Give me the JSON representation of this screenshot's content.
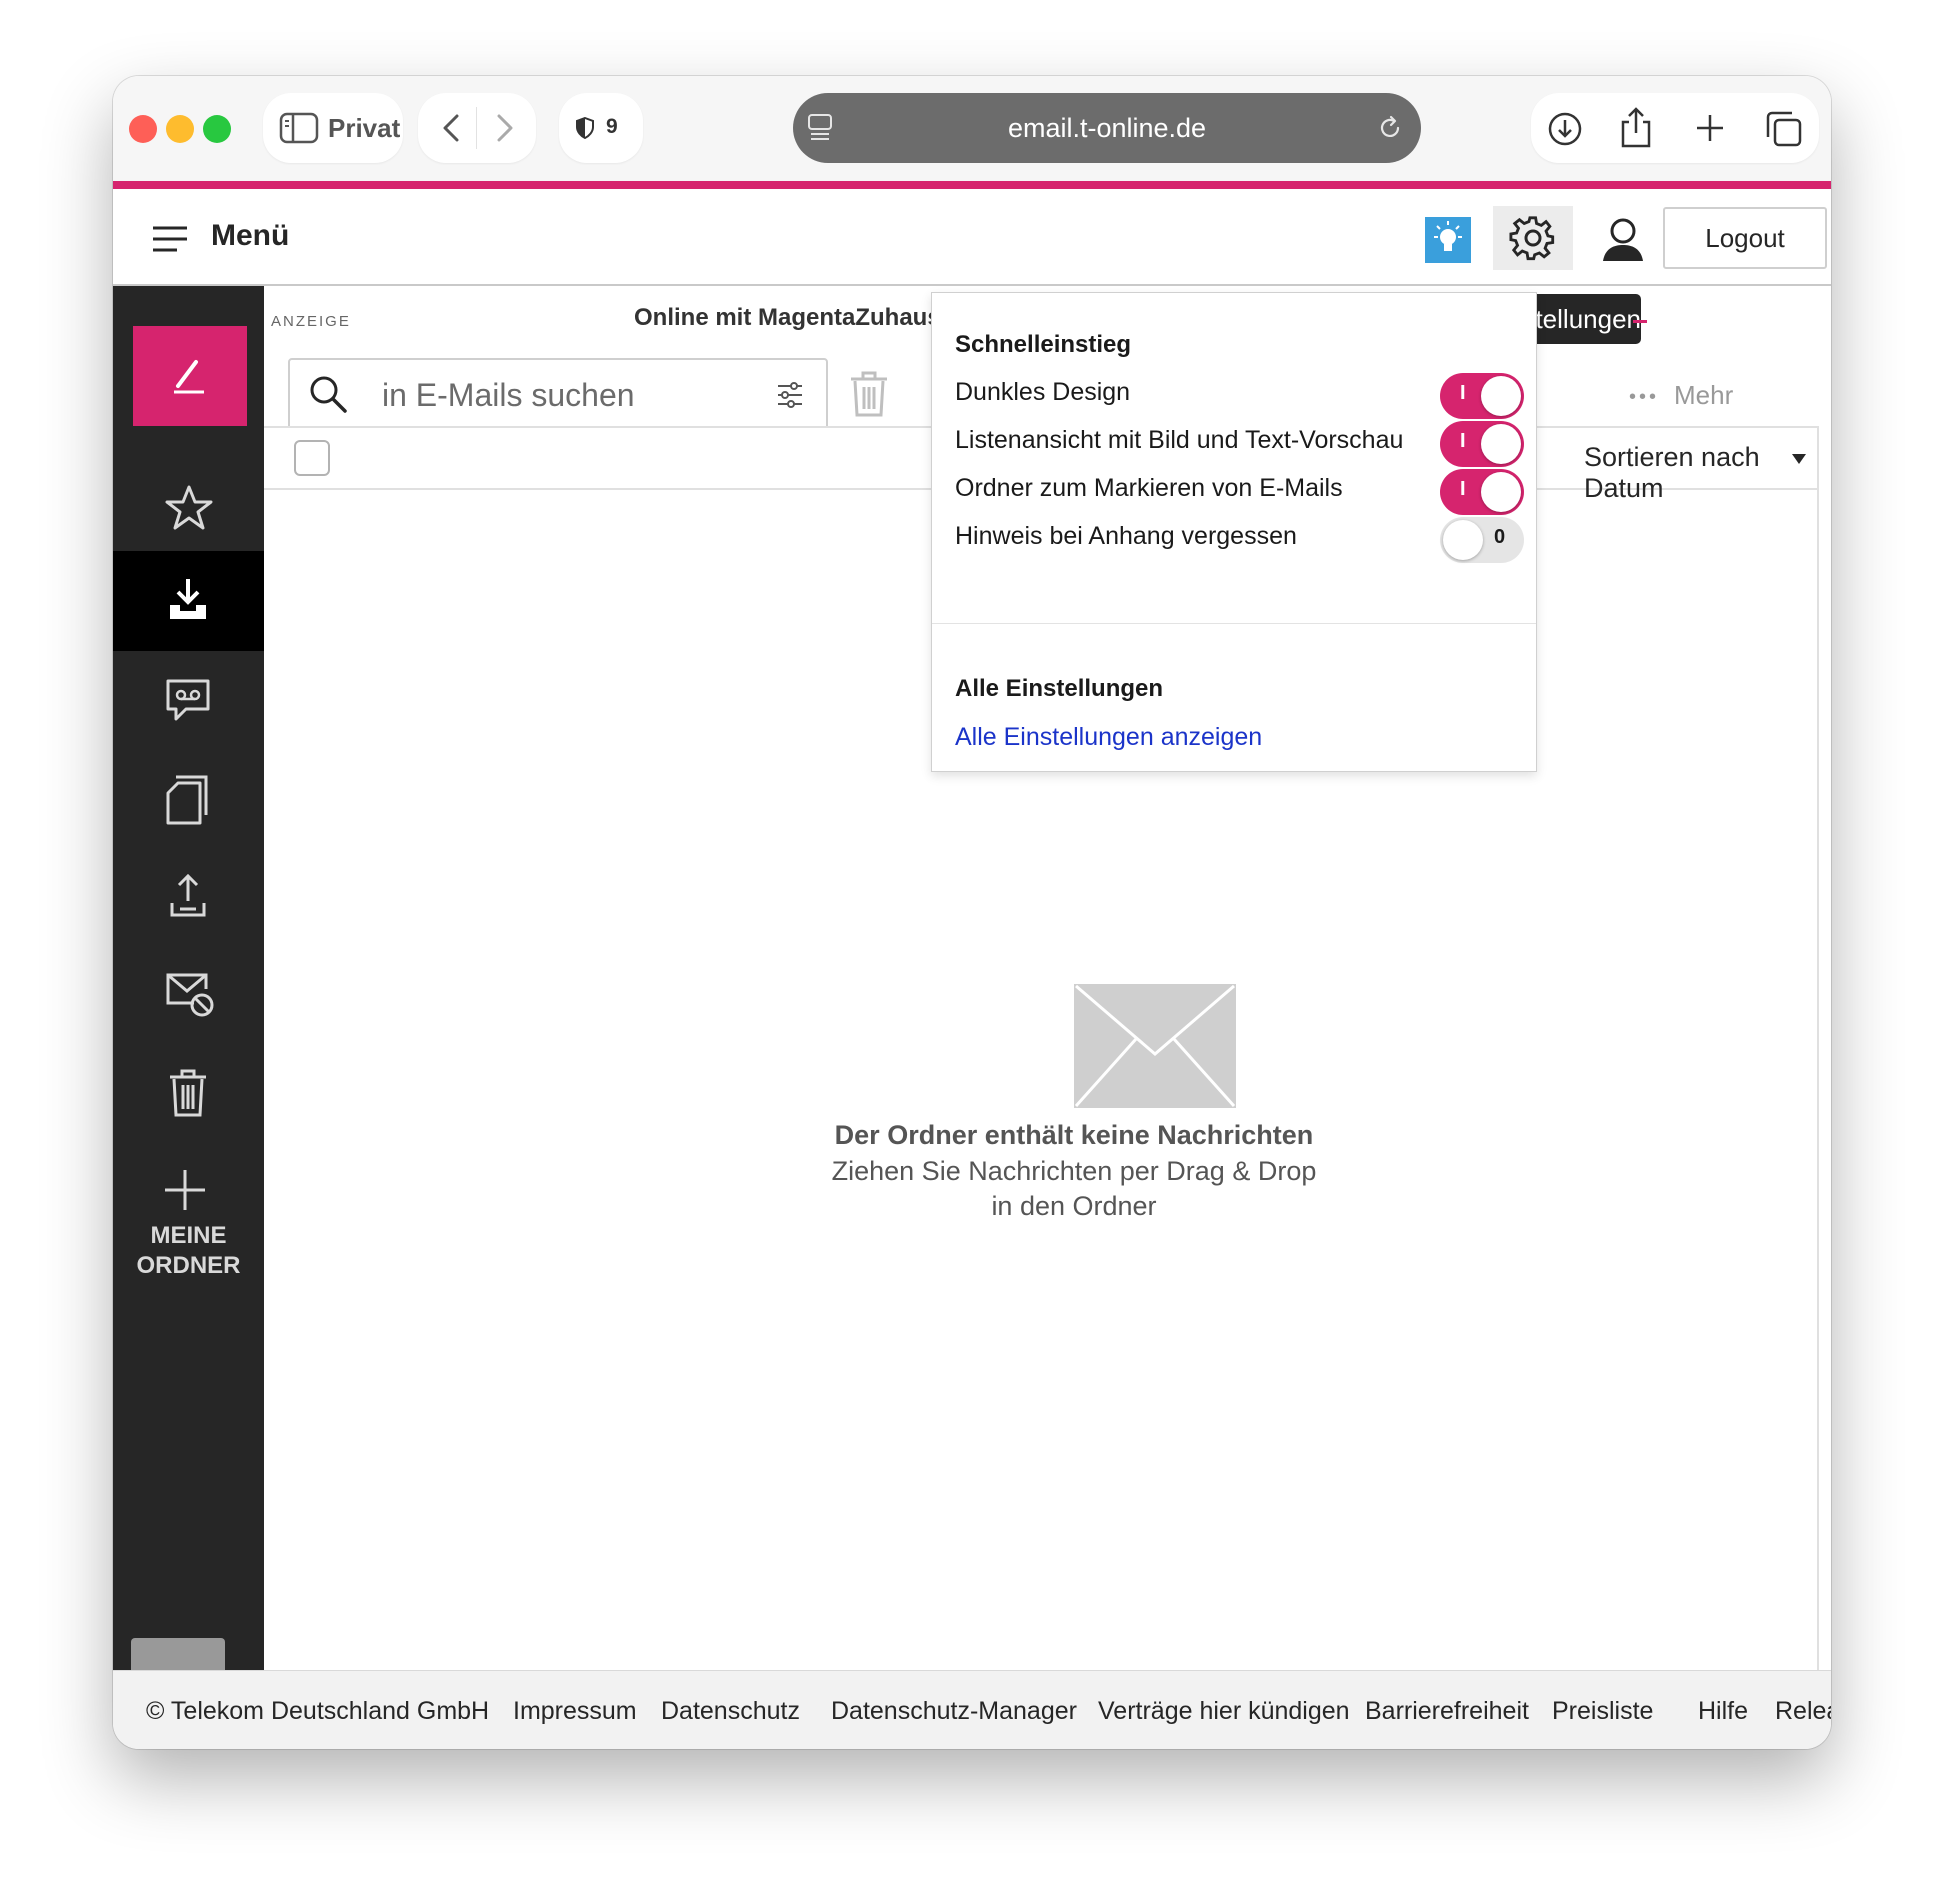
{
  "browser": {
    "profile_label": "Privat",
    "shield_count": "9",
    "url": "email.t-online.de"
  },
  "header": {
    "menu_label": "Menü",
    "logout_label": "Logout"
  },
  "sidebar": {
    "items": [
      "compose",
      "favorites",
      "inbox",
      "voicemail",
      "drafts",
      "sent",
      "spam",
      "trash"
    ],
    "selected": "inbox",
    "my_folders_line1": "MEINE",
    "my_folders_line2": "ORDNER"
  },
  "ad": {
    "label": "ANZEIGE",
    "title": "Online mit MagentaZuhause"
  },
  "toolbar": {
    "search_placeholder": "in E-Mails suchen",
    "more_label": "Mehr",
    "sort_label": "Sortieren nach Datum"
  },
  "empty_state": {
    "title": "Der Ordner enthält keine Nachrichten",
    "subtitle": "Ziehen Sie Nachrichten per Drag & Drop in den Ordner"
  },
  "settings_tooltip": "Einstellungen",
  "quick_settings": {
    "heading": "Schnelleinstieg",
    "options": [
      {
        "label": "Dunkles Design",
        "state": "I",
        "on": true
      },
      {
        "label": "Listenansicht mit Bild und Text-Vorschau",
        "state": "I",
        "on": true
      },
      {
        "label": "Ordner zum Markieren von E-Mails",
        "state": "I",
        "on": true
      },
      {
        "label": "Hinweis bei Anhang vergessen",
        "state": "0",
        "on": false
      }
    ],
    "all_settings_heading": "Alle Einstellungen",
    "all_settings_link": "Alle Einstellungen anzeigen"
  },
  "footer": {
    "copyright": "© Telekom Deutschland GmbH",
    "links": [
      "Impressum",
      "Datenschutz",
      "Datenschutz-Manager",
      "Verträge hier kündigen",
      "Barrierefreiheit",
      "Preisliste",
      "Hilfe",
      "Release Notes"
    ]
  },
  "colors": {
    "brand": "#d6246e",
    "sidebar": "#262626",
    "link": "#1b34c9"
  }
}
